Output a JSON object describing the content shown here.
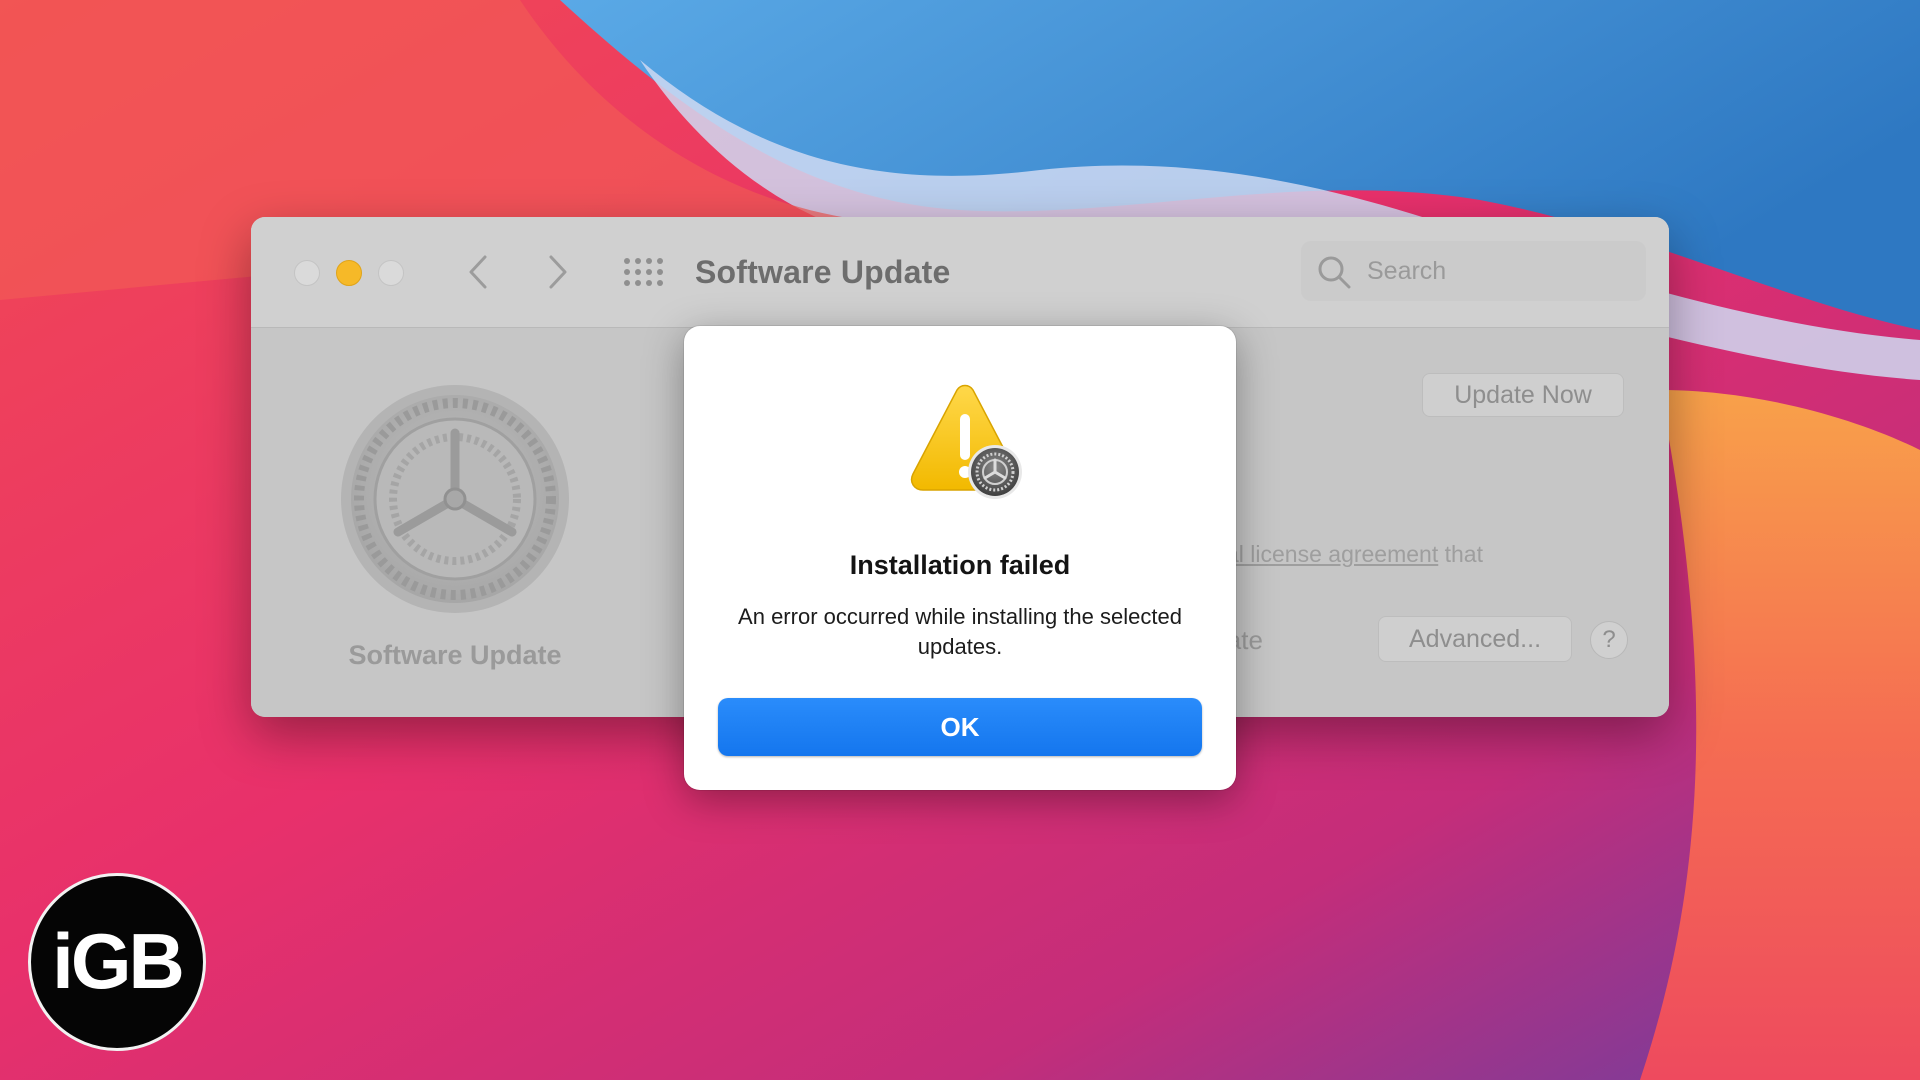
{
  "window": {
    "title": "Software Update",
    "search_placeholder": "Search",
    "sidebar_label": "Software Update",
    "update_now_label": "Update Now",
    "license_link_fragment": "al license agreement",
    "license_trailing": " that",
    "partial_label": "late",
    "advanced_label": "Advanced...",
    "help_label": "?"
  },
  "alert": {
    "title": "Installation failed",
    "message": "An error occurred while installing the selected updates.",
    "ok_label": "OK"
  },
  "logo": {
    "text": "iGB"
  },
  "colors": {
    "accent_blue": "#1476ee",
    "minimize_yellow": "#f6b928",
    "warning_yellow": "#f7c600"
  }
}
